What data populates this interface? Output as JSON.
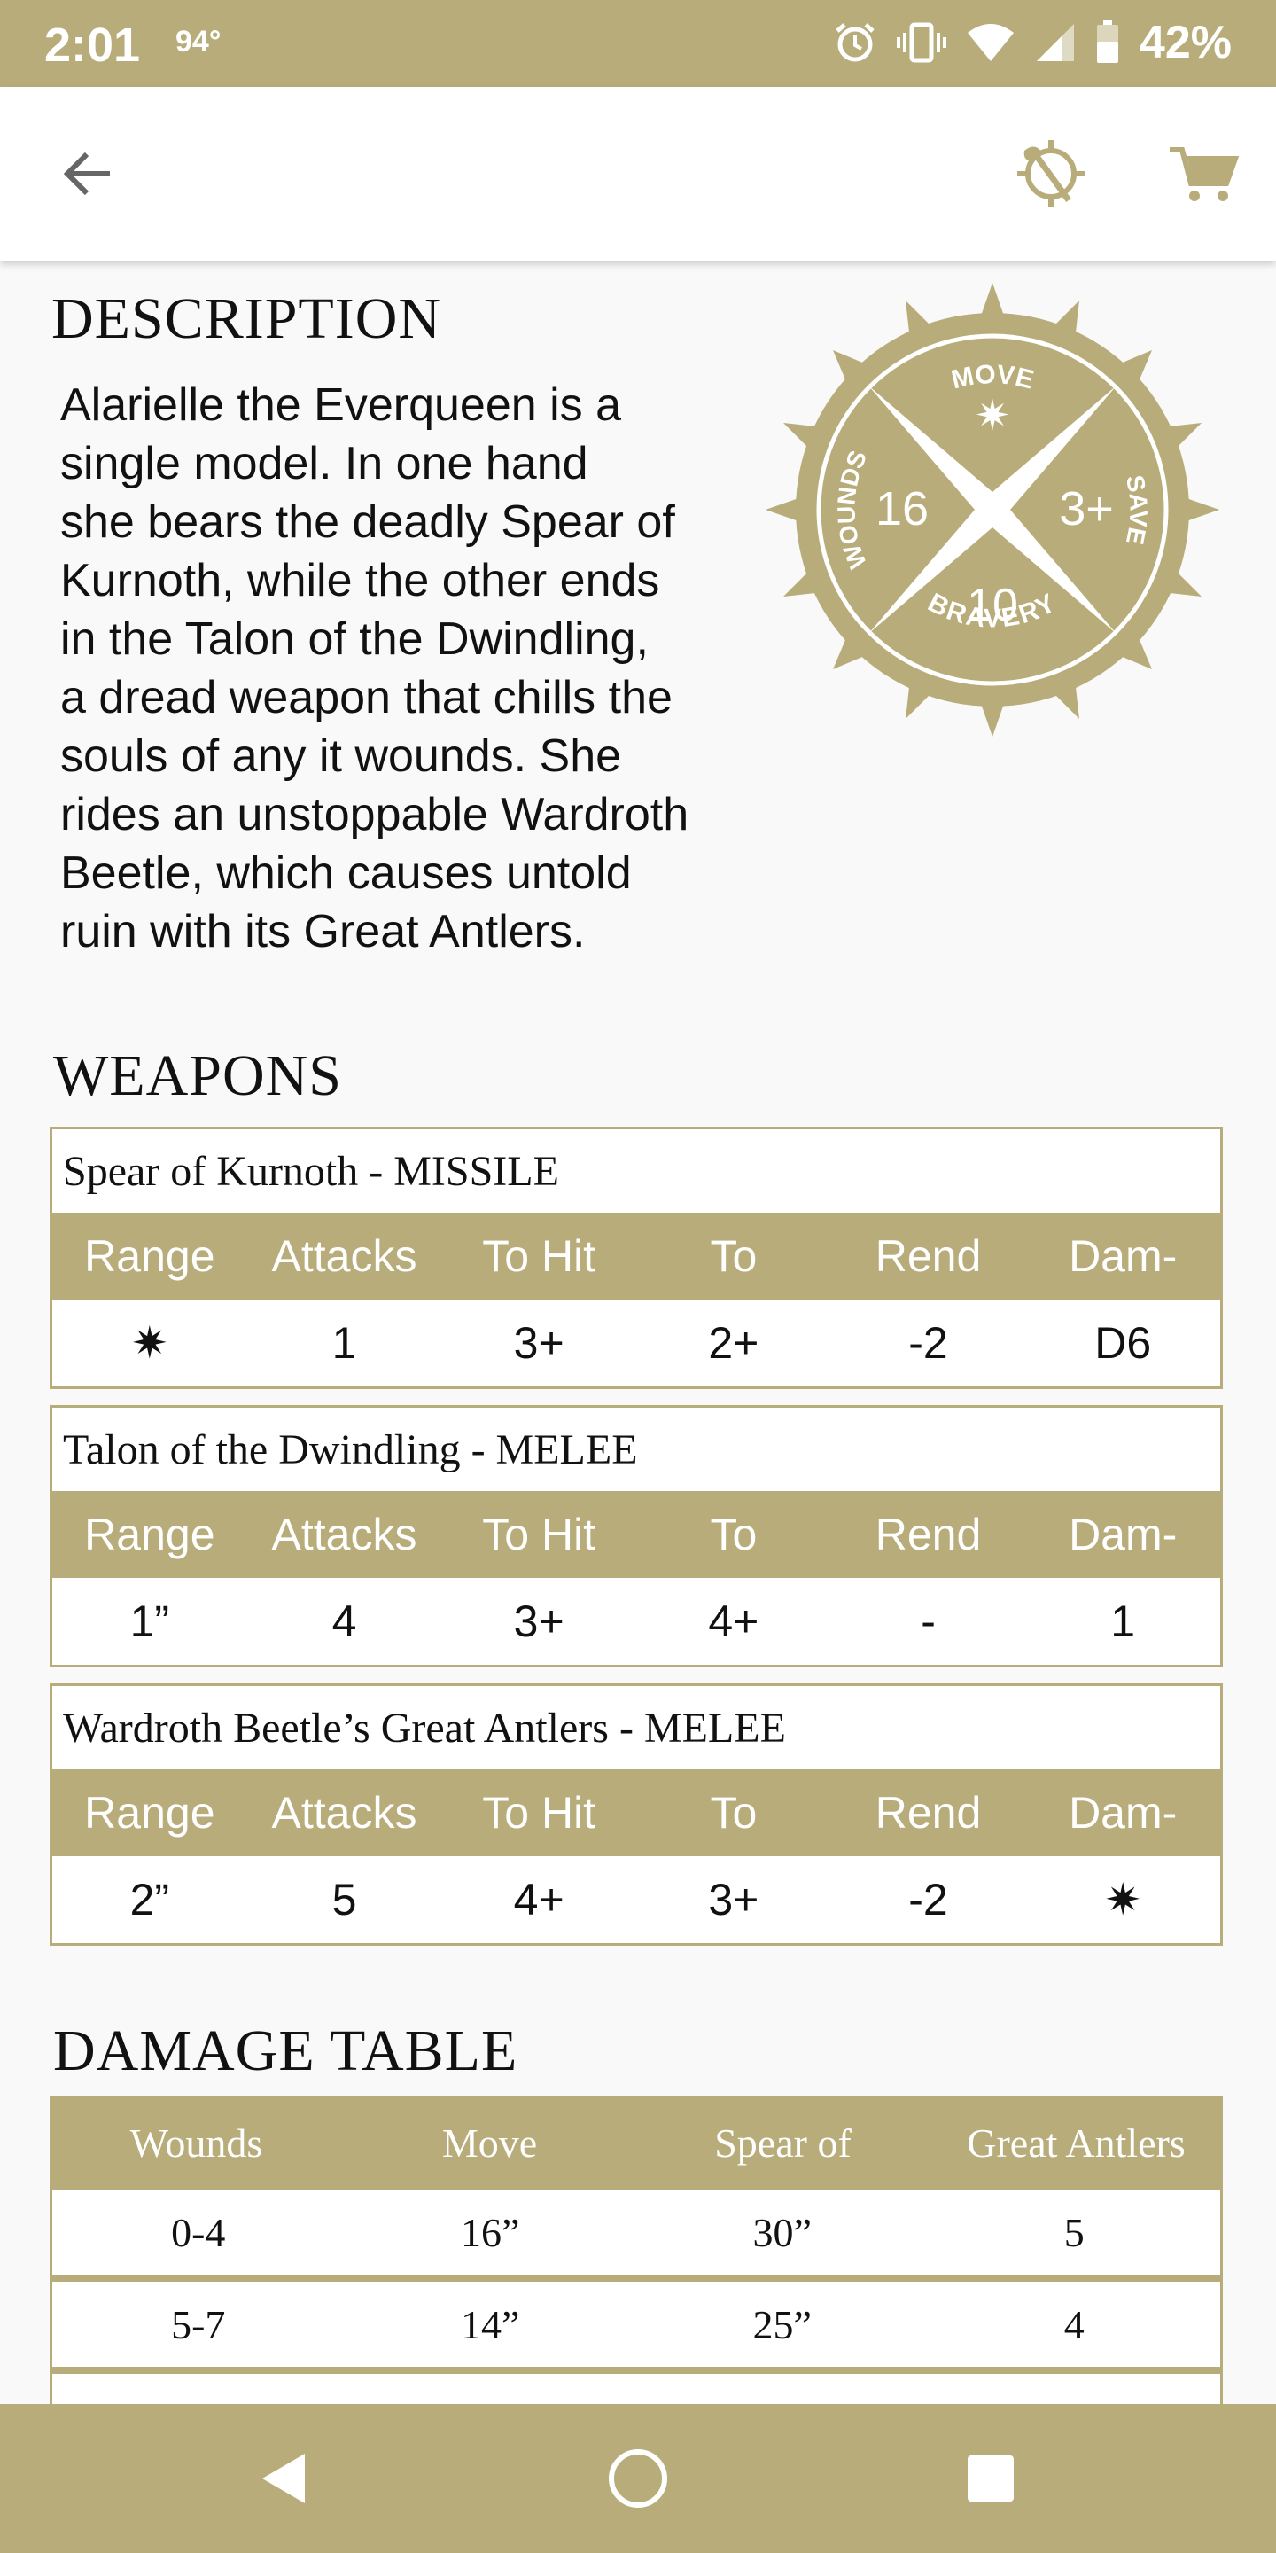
{
  "status_bar": {
    "time": "2:01",
    "temperature": "94°",
    "battery": "42%",
    "icons": [
      "alarm-icon",
      "vibrate-icon",
      "wifi-icon",
      "signal-icon",
      "battery-icon"
    ]
  },
  "app_bar": {
    "icons": [
      "back-arrow-icon",
      "compass-axe-icon",
      "cart-icon"
    ]
  },
  "description": {
    "title": "DESCRIPTION",
    "text_lines": [
      "Alarielle the Everqueen is a",
      "single model. In one hand",
      "she bears the deadly Spear of",
      "Kurnoth, while the other ends",
      "in the Talon of the Dwindling,",
      "a dread weapon that chills the",
      "souls of any it wounds. She",
      "rides an unstoppable Wardroth",
      "Beetle, which causes untold",
      "ruin with its Great Antlers."
    ]
  },
  "stats": {
    "move_label": "MOVE",
    "move_value": "✷",
    "wounds_label": "WOUNDS",
    "wounds_value": "16",
    "save_label": "SAVE",
    "save_value": "3+",
    "bravery_label": "BRAVERY",
    "bravery_value": "10"
  },
  "weapons": {
    "title": "WEAPONS",
    "headers": [
      "Range",
      "Attacks",
      "To Hit",
      "To",
      "Rend",
      "Dam-"
    ],
    "items": [
      {
        "name": "Spear of Kurnoth - MISSILE",
        "values": [
          "✷",
          "1",
          "3+",
          "2+",
          "-2",
          "D6"
        ]
      },
      {
        "name": "Talon of the Dwindling - MELEE",
        "values": [
          "1”",
          "4",
          "3+",
          "4+",
          "-",
          "1"
        ]
      },
      {
        "name": "Wardroth Beetle’s Great Antlers - MELEE",
        "values": [
          "2”",
          "5",
          "4+",
          "3+",
          "-2",
          "✷"
        ]
      }
    ]
  },
  "damage_table": {
    "title": "DAMAGE TABLE",
    "headers": [
      "Wounds",
      "Move",
      "Spear of",
      "Great Antlers"
    ],
    "rows": [
      [
        "0-4",
        "16”",
        "30”",
        "5"
      ],
      [
        "5-7",
        "14”",
        "25”",
        "4"
      ]
    ]
  },
  "colors": {
    "accent": "#b8ad7a",
    "background": "#f9f9f9"
  }
}
